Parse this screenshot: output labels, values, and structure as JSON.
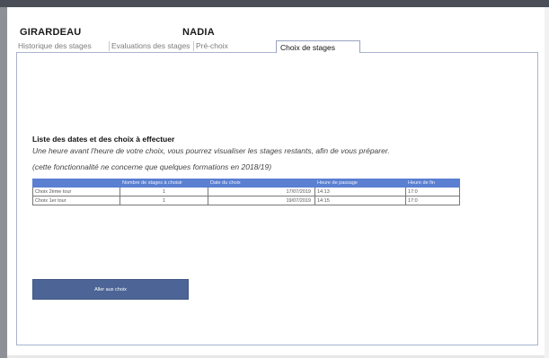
{
  "user": {
    "last_name": "GIRARDEAU",
    "first_name": "NADIA"
  },
  "tabs": [
    {
      "label": "Historique des stages"
    },
    {
      "label": "Evaluations des stages"
    },
    {
      "label": "Pré-choix"
    },
    {
      "label": "Choix de stages"
    }
  ],
  "active_tab": "Choix de stages",
  "section": {
    "title": "Liste des dates et des choix à effectuer",
    "info_line1": "Une heure avant l'heure de votre choix, vous pourrez visualiser les stages restants, afin de vous préparer.",
    "info_line2": "(cette fonctionnalité ne concerne que quelques formations en 2018/19)"
  },
  "table": {
    "headers": [
      "",
      "Nombre de stages à choisir",
      "Date du choix",
      "Heure de passage",
      "Heure de fin"
    ],
    "rows": [
      [
        "Choix 2ème tour",
        "1",
        "17/07/2019",
        "14:13",
        "17:0"
      ],
      [
        "Choix 1er tour",
        "1",
        "19/07/2019",
        "14:15",
        "17:0"
      ]
    ]
  },
  "action_button": {
    "label": "Aller aux choix"
  },
  "colors": {
    "header_bg": "#5b7fd1",
    "button_bg": "#4c6596",
    "panel_border": "#aab3cf"
  }
}
